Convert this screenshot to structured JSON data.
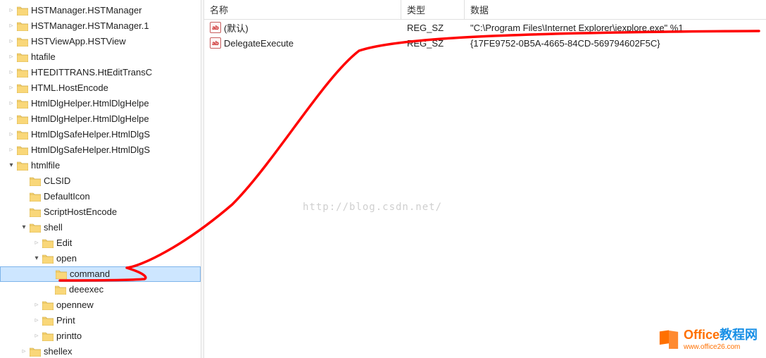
{
  "tree": {
    "items": [
      {
        "indent": 0,
        "expander": "▷",
        "label": "HSTManager.HSTManager"
      },
      {
        "indent": 0,
        "expander": "▷",
        "label": "HSTManager.HSTManager.1"
      },
      {
        "indent": 0,
        "expander": "▷",
        "label": "HSTViewApp.HSTView"
      },
      {
        "indent": 0,
        "expander": "▷",
        "label": "htafile"
      },
      {
        "indent": 0,
        "expander": "▷",
        "label": "HTEDITTRANS.HtEditTransC"
      },
      {
        "indent": 0,
        "expander": "▷",
        "label": "HTML.HostEncode"
      },
      {
        "indent": 0,
        "expander": "▷",
        "label": "HtmlDlgHelper.HtmlDlgHelpe"
      },
      {
        "indent": 0,
        "expander": "▷",
        "label": "HtmlDlgHelper.HtmlDlgHelpe"
      },
      {
        "indent": 0,
        "expander": "▷",
        "label": "HtmlDlgSafeHelper.HtmlDlgS"
      },
      {
        "indent": 0,
        "expander": "▷",
        "label": "HtmlDlgSafeHelper.HtmlDlgS"
      },
      {
        "indent": 0,
        "expander": "◢",
        "label": "htmlfile"
      },
      {
        "indent": 1,
        "expander": "",
        "label": "CLSID"
      },
      {
        "indent": 1,
        "expander": "",
        "label": "DefaultIcon"
      },
      {
        "indent": 1,
        "expander": "",
        "label": "ScriptHostEncode"
      },
      {
        "indent": 1,
        "expander": "◢",
        "label": "shell"
      },
      {
        "indent": 2,
        "expander": "▷",
        "label": "Edit"
      },
      {
        "indent": 2,
        "expander": "◢",
        "label": "open"
      },
      {
        "indent": 3,
        "expander": "",
        "label": "command",
        "selected": true
      },
      {
        "indent": 3,
        "expander": "",
        "label": "deeexec"
      },
      {
        "indent": 2,
        "expander": "▷",
        "label": "opennew"
      },
      {
        "indent": 2,
        "expander": "▷",
        "label": "Print"
      },
      {
        "indent": 2,
        "expander": "▷",
        "label": "printto"
      },
      {
        "indent": 1,
        "expander": "▷",
        "label": "shellex"
      }
    ]
  },
  "list": {
    "headers": {
      "name": "名称",
      "type": "类型",
      "data": "数据"
    },
    "rows": [
      {
        "icon": "ab",
        "name": "(默认)",
        "type": "REG_SZ",
        "data": "\"C:\\Program Files\\Internet Explorer\\iexplore.exe\" %1"
      },
      {
        "icon": "ab",
        "name": "DelegateExecute",
        "type": "REG_SZ",
        "data": "{17FE9752-0B5A-4665-84CD-569794602F5C}"
      }
    ]
  },
  "watermark": "http://blog.csdn.net/",
  "brand": {
    "title": "Office教程网",
    "url": "www.office26.com"
  }
}
